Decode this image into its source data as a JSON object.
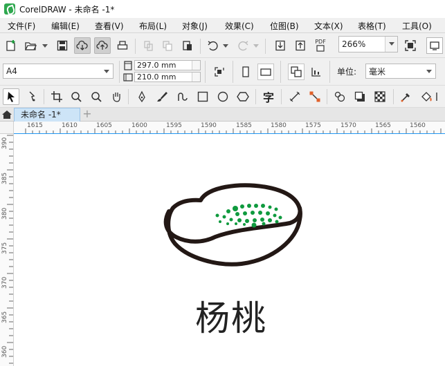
{
  "window": {
    "title": "CorelDRAW - 未命名 -1*"
  },
  "menu": [
    {
      "label": "文件(F)"
    },
    {
      "label": "编辑(E)"
    },
    {
      "label": "查看(V)"
    },
    {
      "label": "布局(L)"
    },
    {
      "label": "对象(J)"
    },
    {
      "label": "效果(C)"
    },
    {
      "label": "位图(B)"
    },
    {
      "label": "文本(X)"
    },
    {
      "label": "表格(T)"
    },
    {
      "label": "工具(O)"
    }
  ],
  "toolbar": {
    "zoom": "266%",
    "pdf_label": "PDF"
  },
  "property_bar": {
    "page_size": "A4",
    "height": "297.0 mm",
    "width": "210.0 mm",
    "units_label": "单位:",
    "units_value": "毫米"
  },
  "tools": {
    "text_tool_glyph": "字"
  },
  "tabs": {
    "active": "未命名 -1*",
    "add": "+"
  },
  "ruler": {
    "horizontal": [
      "1615",
      "1610",
      "1605",
      "1600",
      "1595",
      "1590",
      "1585",
      "1580",
      "1575",
      "1570",
      "1565",
      "1560"
    ],
    "vertical": [
      "390",
      "385",
      "380",
      "375",
      "370",
      "365",
      "360"
    ]
  },
  "canvas": {
    "caption": "杨桃",
    "colors": {
      "outline": "#231815",
      "dots": "#0f9a3e"
    }
  }
}
